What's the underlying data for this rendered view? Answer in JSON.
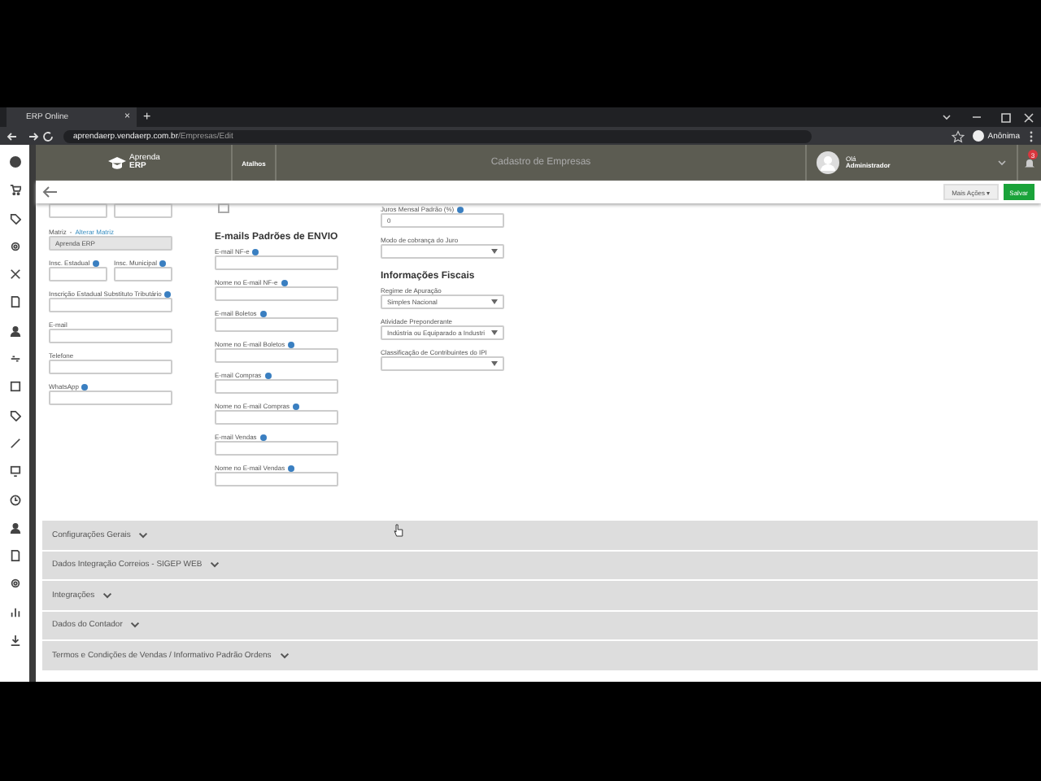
{
  "browser": {
    "tab": {
      "title": "ERP Online",
      "close": "×"
    },
    "new_tab": "+",
    "url_host": "aprendaerp.vendaerp.com.br",
    "url_path": "/Empresas/Edit",
    "profile": "Anônima"
  },
  "header": {
    "logo_top": "Aprenda",
    "logo_bottom": "ERP",
    "shortcuts": "Atalhos",
    "title": "Cadastro de Empresas",
    "greeting": "Olá",
    "user": "Administrador",
    "notifications": "3"
  },
  "toolbar": {
    "more_actions": "Mais Ações",
    "more_caret": "▾",
    "save": "Salvar"
  },
  "columns": [
    [
      {
        "kind": "cut_pair"
      },
      {
        "kind": "field",
        "label": "Matriz",
        "separator": "-",
        "link": "Alterar Matriz",
        "value": "Aprenda ERP",
        "disabled": true,
        "info": false
      },
      {
        "kind": "pair",
        "fields": [
          {
            "label": "Insc. Estadual",
            "info": true
          },
          {
            "label": "Insc. Municipal",
            "info": true
          }
        ]
      },
      {
        "kind": "field",
        "label": "Inscrição Estadual Substituto Tributário",
        "info": true,
        "disabled": false
      },
      {
        "kind": "field",
        "label": "E-mail",
        "info": false,
        "disabled": false
      },
      {
        "kind": "field",
        "label": "Telefone",
        "info": false,
        "disabled": false
      },
      {
        "kind": "field",
        "label": "WhatsApp",
        "info": true,
        "disabled": false
      }
    ],
    [
      {
        "kind": "checkbox",
        "checked": false
      },
      {
        "kind": "heading",
        "text": "E-mails Padrões de ENVIO"
      },
      {
        "kind": "field",
        "label": "E-mail NF-e",
        "info": true,
        "disabled": false
      },
      {
        "kind": "field",
        "label": "Nome no E-mail NF-e",
        "info": true,
        "disabled": false
      },
      {
        "kind": "field",
        "label": "E-mail Boletos",
        "info": true,
        "disabled": false
      },
      {
        "kind": "field",
        "label": "Nome no E-mail Boletos",
        "info": true,
        "disabled": false
      },
      {
        "kind": "field",
        "label": "E-mail Compras",
        "info": true,
        "disabled": false
      },
      {
        "kind": "field",
        "label": "Nome no E-mail Compras",
        "info": true,
        "disabled": false
      },
      {
        "kind": "field",
        "label": "E-mail Vendas",
        "info": true,
        "disabled": false
      },
      {
        "kind": "field",
        "label": "Nome no E-mail Vendas",
        "info": true,
        "disabled": false
      }
    ],
    [
      {
        "kind": "field",
        "label": "Juros Mensal Padrão (%)",
        "value": "0",
        "info": true,
        "disabled": false
      },
      {
        "kind": "select",
        "label": "Modo de cobrança do Juro"
      },
      {
        "kind": "heading",
        "text": "Informações Fiscais"
      },
      {
        "kind": "select",
        "label": "Regime de Apuração",
        "value": "Simples Nacional"
      },
      {
        "kind": "select",
        "label": "Atividade Preponderante",
        "value": "Indústria ou Equiparado a Industri"
      },
      {
        "kind": "select",
        "label": "Classificação de Contribuintes do IPI"
      }
    ]
  ],
  "sections": [
    {
      "title": "Configurações Gerais",
      "expanded": false
    },
    {
      "title": "Dados Integração Correios - SIGEP WEB",
      "expanded": false
    },
    {
      "title": "Integrações",
      "expanded": false
    },
    {
      "title": "Dados do Contador",
      "expanded": false
    },
    {
      "title": "Termos e Condições de Vendas / Informativo Padrão Ordens",
      "expanded": false
    }
  ]
}
